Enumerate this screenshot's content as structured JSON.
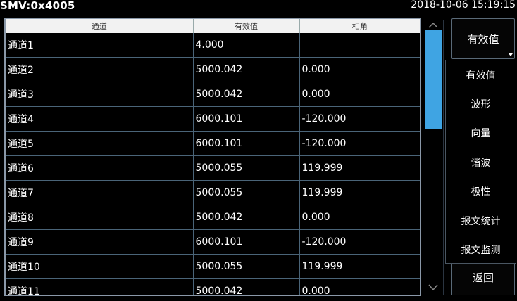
{
  "header": {
    "title": "SMV:0x4005",
    "datetime": "2018-10-06 15:19:15"
  },
  "table": {
    "columns": [
      "通道",
      "有效值",
      "相角"
    ],
    "rows": [
      [
        "通道1",
        "4.000",
        ""
      ],
      [
        "通道2",
        "5000.042",
        "0.000"
      ],
      [
        "通道3",
        "5000.042",
        "0.000"
      ],
      [
        "通道4",
        "6000.101",
        "-120.000"
      ],
      [
        "通道5",
        "6000.101",
        "-120.000"
      ],
      [
        "通道6",
        "5000.055",
        "119.999"
      ],
      [
        "通道7",
        "5000.055",
        "119.999"
      ],
      [
        "通道8",
        "5000.042",
        "0.000"
      ],
      [
        "通道9",
        "6000.101",
        "-120.000"
      ],
      [
        "通道10",
        "5000.055",
        "119.999"
      ],
      [
        "通道11",
        "5000.042",
        "0.000"
      ]
    ]
  },
  "scrollbar": {
    "up_icon": "chevron-up-icon",
    "down_icon": "chevron-down-icon",
    "thumb_color": "#3fa4e3"
  },
  "side": {
    "top_button": "有效值",
    "back_button": "返回"
  },
  "menu": {
    "items": [
      "有效值",
      "波形",
      "向量",
      "谐波",
      "极性",
      "报文统计",
      "报文监测"
    ]
  }
}
